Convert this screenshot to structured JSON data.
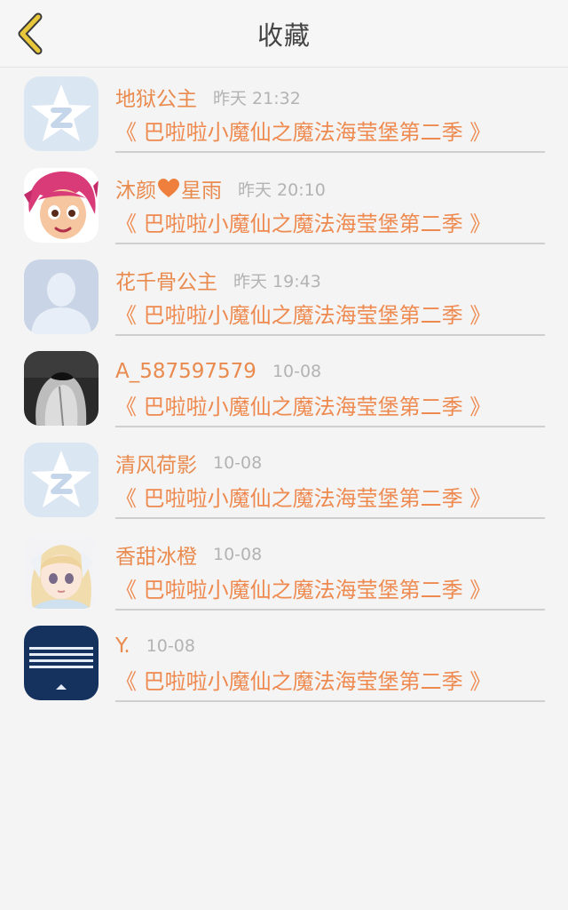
{
  "header": {
    "title": "收藏"
  },
  "icons": {
    "back": "chevron-left-icon",
    "heart": "heart-icon"
  },
  "colors": {
    "accent": "#ee8a50",
    "back_icon": "#e8c83a"
  },
  "items": [
    {
      "name": "地狱公主",
      "time": "昨天 21:32",
      "title": "《 巴啦啦小魔仙之魔法海莹堡第二季 》",
      "avatar": "qq-star-avatar"
    },
    {
      "name_part1": "沐颜",
      "name_part2": "星雨",
      "time": "昨天 20:10",
      "title": "《 巴啦啦小魔仙之魔法海莹堡第二季 》",
      "avatar": "cartoon-girl-avatar"
    },
    {
      "name": "花千骨公主",
      "time": "昨天 19:43",
      "title": "《 巴啦啦小魔仙之魔法海莹堡第二季 》",
      "avatar": "default-person-avatar"
    },
    {
      "name": "A_587597579",
      "time": "10-08",
      "title": "《 巴啦啦小魔仙之魔法海莹堡第二季 》",
      "avatar": "monochrome-photo-avatar"
    },
    {
      "name": "清风荷影",
      "time": "10-08",
      "title": "《 巴啦啦小魔仙之魔法海莹堡第二季 》",
      "avatar": "qq-star-avatar"
    },
    {
      "name": "香甜冰橙",
      "time": "10-08",
      "title": "《 巴啦啦小魔仙之魔法海莹堡第二季 》",
      "avatar": "anime-girl-avatar"
    },
    {
      "name": "Y.",
      "time": "10-08",
      "title": "《 巴啦啦小魔仙之魔法海莹堡第二季 》",
      "avatar": "blue-stripes-avatar"
    }
  ]
}
